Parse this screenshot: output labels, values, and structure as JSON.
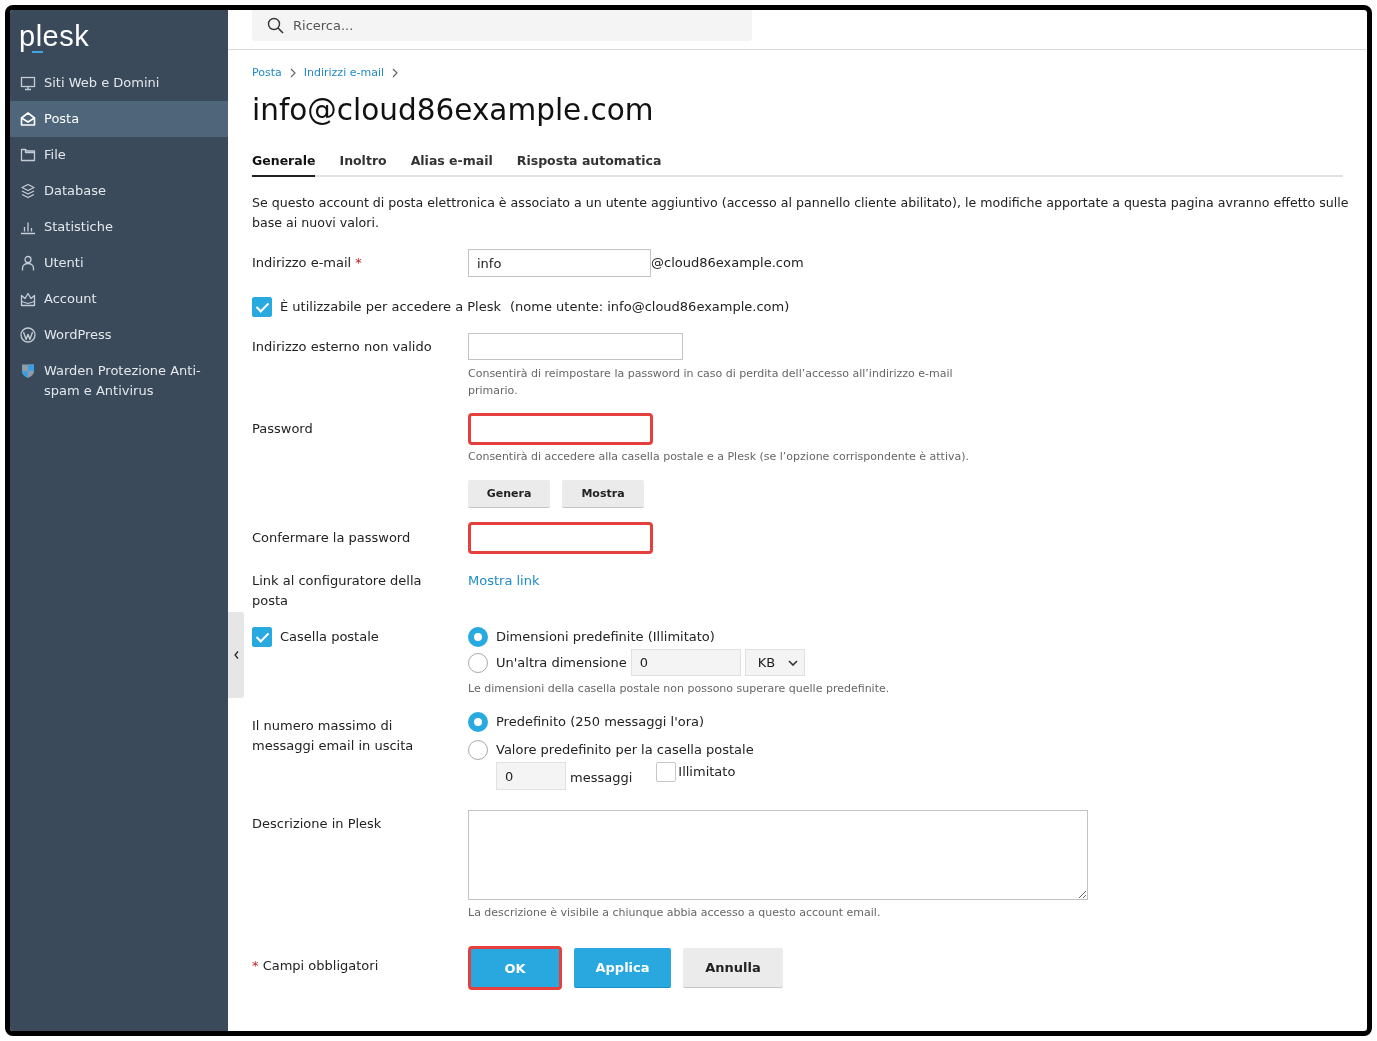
{
  "sidebar": {
    "logo": "plesk",
    "items": [
      {
        "label": "Siti Web e Domini",
        "selected": false
      },
      {
        "label": "Posta",
        "selected": true
      },
      {
        "label": "File",
        "selected": false
      },
      {
        "label": "Database",
        "selected": false
      },
      {
        "label": "Statistiche",
        "selected": false
      },
      {
        "label": "Utenti",
        "selected": false
      },
      {
        "label": "Account",
        "selected": false
      },
      {
        "label": "WordPress",
        "selected": false
      },
      {
        "label": "Warden Protezione Anti-spam e Antivirus",
        "selected": false
      }
    ]
  },
  "search": {
    "placeholder": "Ricerca..."
  },
  "breadcrumb": [
    "Posta",
    "Indirizzi e-mail"
  ],
  "title": "info@cloud86example.com",
  "tabs": [
    {
      "label": "Generale",
      "selected": true
    },
    {
      "label": "Inoltro",
      "selected": false
    },
    {
      "label": "Alias e-mail",
      "selected": false
    },
    {
      "label": "Risposta automatica",
      "selected": false
    }
  ],
  "intro": [
    "Se questo account di posta elettronica è associato a un utente aggiuntivo (accesso al pannello cliente abilitato), le modifiche apportate a questa pagina avranno effetto sulle",
    "base ai nuovi valori."
  ],
  "form": {
    "email": {
      "label": "Indirizzo e-mail",
      "required_mark": "*",
      "value": "info",
      "suffix": "@cloud86example.com"
    },
    "login": {
      "label": "È utilizzabile per accedere a Plesk",
      "note": "(nome utente: info@cloud86example.com)",
      "checked": true
    },
    "external_address": {
      "label": "Indirizzo esterno non valido",
      "hint": "Consentirà di reimpostare la password in caso di perdita dell’accesso all’indirizzo e-mail primario."
    },
    "password": {
      "label": "Password",
      "highlighted": true,
      "hint": "Consentirà di accedere alla casella postale e a Plesk (se l’opzione corrispondente è attiva).",
      "buttons": [
        "Genera",
        "Mostra"
      ]
    },
    "confirm_password": {
      "label": "Confermare la password",
      "highlighted": true
    },
    "configurator_link": {
      "label": "Link al configuratore della posta",
      "link": "Mostra link"
    },
    "mailbox": {
      "label": "Casella postale",
      "checked": true,
      "options": [
        {
          "label": "Dimensioni predefinite (Illimitato)",
          "selected": true
        },
        {
          "label": "Un'altra dimensione",
          "selected": false,
          "value": "0",
          "unit": "KB"
        }
      ],
      "hint": "Le dimensioni della casella postale non possono superare quelle predefinite."
    },
    "outgoing_limit": {
      "label": "Il numero massimo di messaggi email in uscita",
      "options": [
        {
          "label": "Predefinito (250 messaggi l'ora)",
          "selected": true
        },
        {
          "label": "Valore predefinito per la casella postale",
          "selected": false
        }
      ],
      "value": "0",
      "suffix": "messaggi",
      "unlimited": {
        "label": "Illimitato",
        "checked": false
      }
    },
    "description": {
      "label": "Descrizione in Plesk",
      "hint": "La descrizione è visibile a chiunque abbia accesso a questo account email."
    },
    "required_note": {
      "mark": "*",
      "text": "Campi obbligatori"
    },
    "buttons": [
      {
        "label": "OK",
        "kind": "primary",
        "highlighted": true
      },
      {
        "label": "Applica",
        "kind": "primary",
        "highlighted": false
      },
      {
        "label": "Annulla",
        "kind": "secondary",
        "highlighted": false
      }
    ]
  }
}
